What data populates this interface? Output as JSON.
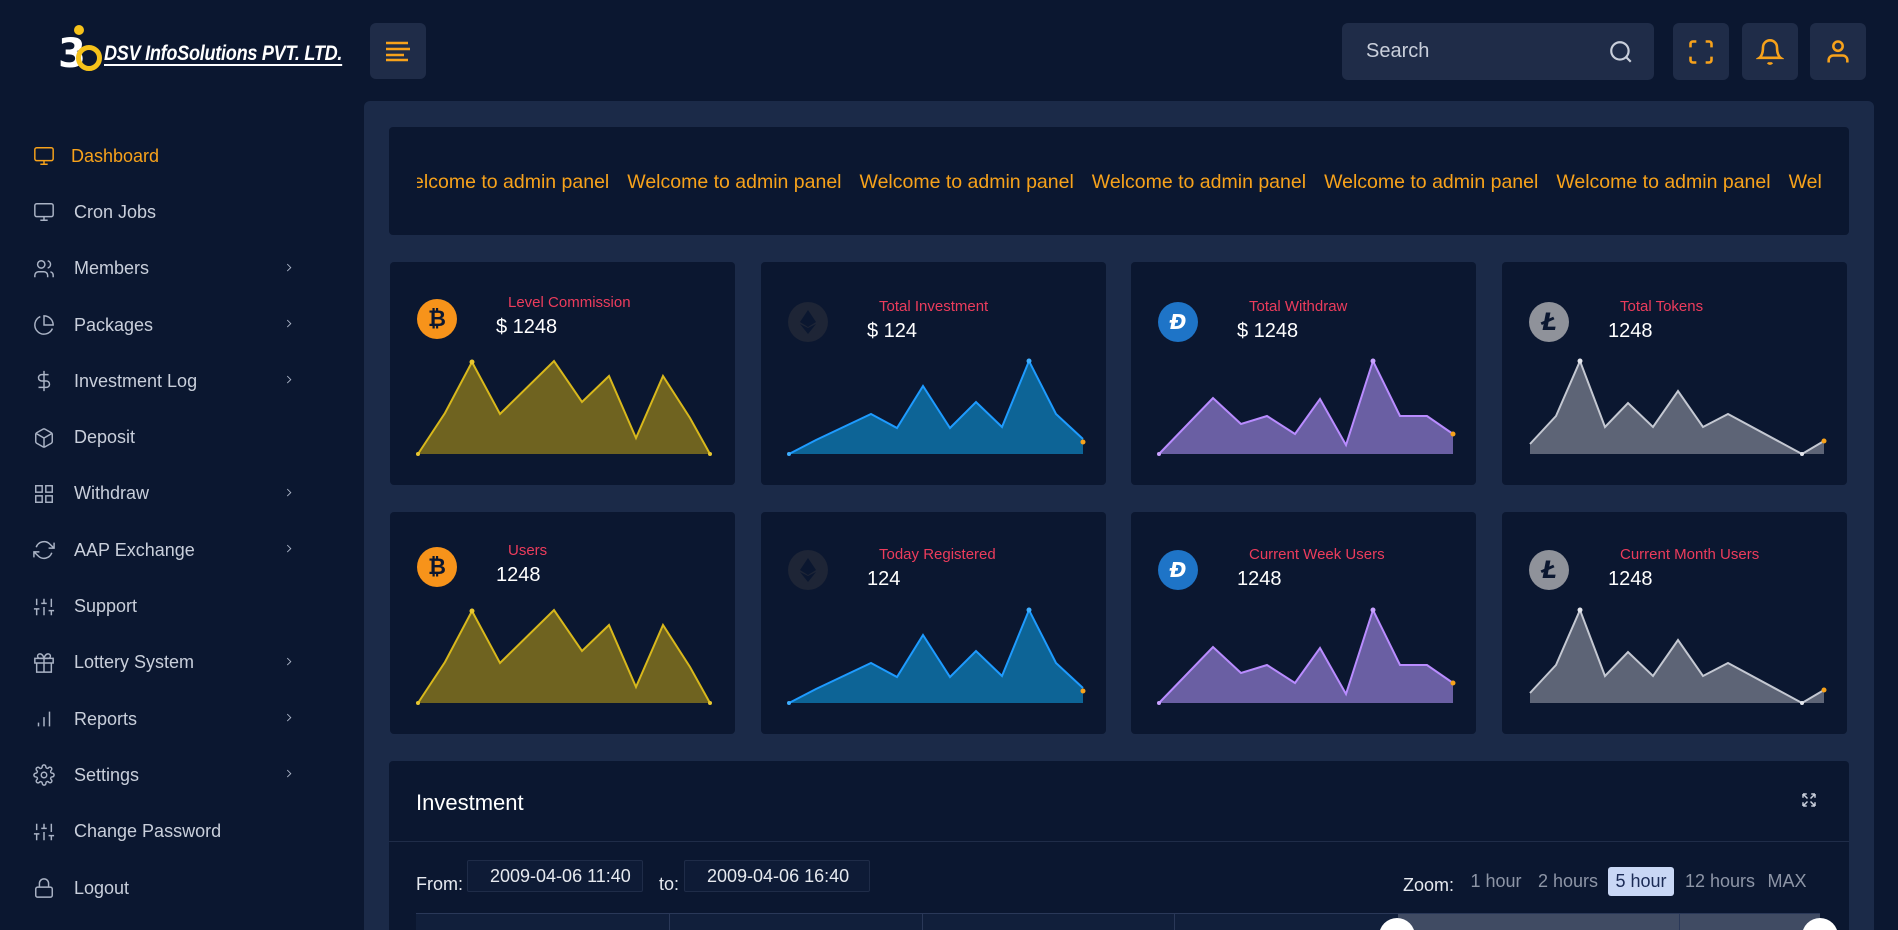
{
  "brand": {
    "mark": "3",
    "name": "DSV InfoSolutions PVT. LTD."
  },
  "sidebar": {
    "items": [
      {
        "label": "Dashboard",
        "icon": "monitor-icon",
        "active": true,
        "has_children": false
      },
      {
        "label": "Cron Jobs",
        "icon": "monitor-icon",
        "active": false,
        "has_children": false
      },
      {
        "label": "Members",
        "icon": "users-icon",
        "active": false,
        "has_children": true
      },
      {
        "label": "Packages",
        "icon": "pie-chart-icon",
        "active": false,
        "has_children": true
      },
      {
        "label": "Investment Log",
        "icon": "dollar-icon",
        "active": false,
        "has_children": true
      },
      {
        "label": "Deposit",
        "icon": "box-icon",
        "active": false,
        "has_children": false
      },
      {
        "label": "Withdraw",
        "icon": "grid-icon",
        "active": false,
        "has_children": true
      },
      {
        "label": "AAP Exchange",
        "icon": "refresh-icon",
        "active": false,
        "has_children": true
      },
      {
        "label": "Support",
        "icon": "sliders-icon",
        "active": false,
        "has_children": false
      },
      {
        "label": "Lottery System",
        "icon": "gift-icon",
        "active": false,
        "has_children": true
      },
      {
        "label": "Reports",
        "icon": "bar-chart-icon",
        "active": false,
        "has_children": true
      },
      {
        "label": "Settings",
        "icon": "gear-icon",
        "active": false,
        "has_children": true
      },
      {
        "label": "Change Password",
        "icon": "sliders-icon",
        "active": false,
        "has_children": false
      },
      {
        "label": "Logout",
        "icon": "lock-icon",
        "active": false,
        "has_children": false
      }
    ]
  },
  "topbar": {
    "search_placeholder": "Search"
  },
  "marquee": {
    "text": "Welcome to admin panel",
    "items": [
      "Welcome to admin panel",
      "Welcome to admin panel",
      "Welcome to admin panel",
      "Welcome to admin panel",
      "Welcome to admin panel",
      "Welcome to admin panel",
      "Welcome to admin panel"
    ]
  },
  "cards": [
    {
      "title": "Level Commission",
      "value": "$ 1248",
      "coin": "bitcoin-icon",
      "color": "#f6c21a"
    },
    {
      "title": "Total Investment",
      "value": "$ 124",
      "coin": "ethereum-icon",
      "color": "#1e9bff"
    },
    {
      "title": "Total Withdraw",
      "value": "$ 1248",
      "coin": "dash-icon",
      "color": "#b98cff"
    },
    {
      "title": "Total Tokens",
      "value": "1248",
      "coin": "litecoin-icon",
      "color": "#c4c8d2"
    },
    {
      "title": "Users",
      "value": "1248",
      "coin": "bitcoin-icon",
      "color": "#f6c21a"
    },
    {
      "title": "Today Registered",
      "value": "124",
      "coin": "ethereum-icon",
      "color": "#1e9bff"
    },
    {
      "title": "Current Week Users",
      "value": "1248",
      "coin": "dash-icon",
      "color": "#b98cff"
    },
    {
      "title": "Current Month Users",
      "value": "1248",
      "coin": "litecoin-icon",
      "color": "#c4c8d2"
    }
  ],
  "investment": {
    "title": "Investment",
    "from_label": "From:",
    "from_value": "2009-04-06 11:40",
    "to_label": "to:",
    "to_value": "2009-04-06 16:40",
    "zoom_label": "Zoom:",
    "zoom_options": [
      "1 hour",
      "2 hours",
      "5 hour",
      "12 hours",
      "MAX"
    ],
    "zoom_selected": "5 hour"
  },
  "colors": {
    "accent": "#f7a21b",
    "card_title": "#ec3c5c",
    "background": "#0b1730",
    "panel": "#1b2a48"
  }
}
